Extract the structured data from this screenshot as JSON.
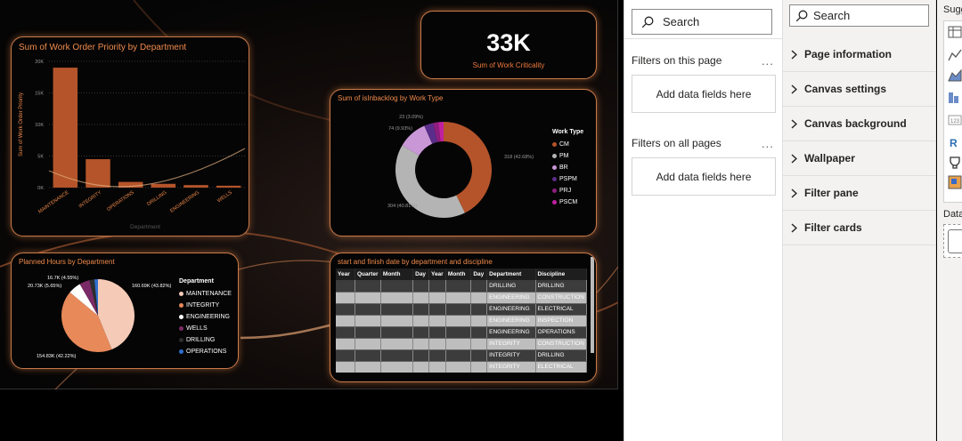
{
  "kpi": {
    "value": "33K",
    "label": "Sum of Work Criticality"
  },
  "bar_chart": {
    "title": "Sum of Work Order Priority by Department",
    "y_ticks": [
      "20K",
      "15K",
      "10K",
      "5K",
      "0K"
    ],
    "ylabel": "Sum of Work Order Priority",
    "xlabel": "Department",
    "categories": [
      "MAINTENANCE",
      "INTEGRITY",
      "OPERATIONS",
      "DRILLING",
      "ENGINEERING",
      "WELLS"
    ]
  },
  "donut_chart": {
    "title": "Sum of isInbacklog by Work Type",
    "legend_title": "Work Type",
    "legend": [
      "CM",
      "PM",
      "BR",
      "PSPM",
      "PRJ",
      "PSCM"
    ],
    "labels": [
      "23 (3.09%)",
      "74 (9.93%)",
      "318 (42.68%)",
      "304 (40.81%)"
    ]
  },
  "pie_chart": {
    "title": "Planned Hours by Department",
    "legend_title": "Department",
    "legend": [
      "MAINTENANCE",
      "INTEGRITY",
      "ENGINEERING",
      "WELLS",
      "DRILLING",
      "OPERATIONS"
    ],
    "labels": [
      "16.7K (4.55%)",
      "20.73K (5.65%)",
      "160.69K (43.82%)",
      "154.83K (42.22%)"
    ]
  },
  "table": {
    "title": "start and finish date by department and discipline",
    "headers": [
      "Year",
      "Quarter",
      "Month",
      "Day",
      "Year",
      "Month",
      "Day",
      "Department",
      "Discipline"
    ],
    "rows": [
      [
        "DRILLING",
        "DRILLING"
      ],
      [
        "ENGINEERING",
        "CONSTRUCTION"
      ],
      [
        "ENGINEERING",
        "ELECTRICAL"
      ],
      [
        "ENGINEERING",
        "INSPECTION"
      ],
      [
        "ENGINEERING",
        "OPERATIONS"
      ],
      [
        "INTEGRITY",
        "CONSTRUCTION"
      ],
      [
        "INTEGRITY",
        "DRILLING"
      ],
      [
        "INTEGRITY",
        "ELECTRICAL"
      ]
    ]
  },
  "filters": {
    "search_placeholder": "Search",
    "on_this_page": "Filters on this page",
    "on_all_pages": "Filters on all pages",
    "add_fields": "Add data fields here",
    "more": "..."
  },
  "format": {
    "search_placeholder": "Search",
    "items": [
      "Page information",
      "Canvas settings",
      "Canvas background",
      "Wallpaper",
      "Filter pane",
      "Filter cards"
    ]
  },
  "viz": {
    "title": "Sugg",
    "data_label": "Data"
  },
  "chart_data": [
    {
      "type": "bar",
      "title": "Sum of Work Order Priority by Department",
      "categories": [
        "MAINTENANCE",
        "INTEGRITY",
        "OPERATIONS",
        "DRILLING",
        "ENGINEERING",
        "WELLS"
      ],
      "values": [
        19000,
        4500,
        900,
        600,
        400,
        300
      ],
      "ylabel": "Sum of Work Order Priority",
      "xlabel": "Department",
      "ylim": [
        0,
        20000
      ],
      "colors": [
        "#b5542a"
      ]
    },
    {
      "type": "pie",
      "title": "Sum of isInbacklog by Work Type",
      "donut": true,
      "categories": [
        "CM",
        "PM",
        "BR",
        "PSPM",
        "PRJ",
        "PSCM"
      ],
      "values": [
        318,
        304,
        74,
        23,
        13,
        13
      ],
      "colors": [
        "#b5542a",
        "#b4b4b4",
        "#c997d6",
        "#5b2d8a",
        "#8e1e7e",
        "#c020a0"
      ]
    },
    {
      "type": "pie",
      "title": "Planned Hours by Department",
      "categories": [
        "MAINTENANCE",
        "INTEGRITY",
        "ENGINEERING",
        "WELLS",
        "DRILLING",
        "OPERATIONS"
      ],
      "values": [
        160.69,
        154.83,
        20.73,
        16.7,
        8,
        5.8
      ],
      "colors": [
        "#f5cbb8",
        "#e8895a",
        "#ffffff",
        "#7a2a66",
        "#2d2d2d",
        "#2f6fcf"
      ]
    }
  ]
}
